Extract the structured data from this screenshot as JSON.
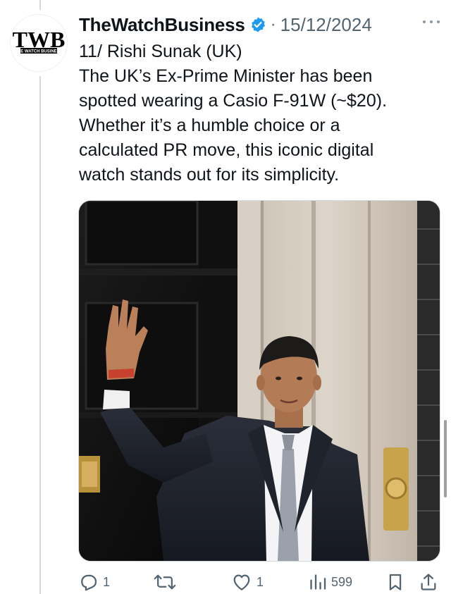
{
  "tweet": {
    "author": {
      "display_name": "TheWatchBusiness",
      "verified": true,
      "avatar_icon": "twb-logo-icon",
      "avatar_text": "TWB",
      "avatar_subtext": "THE WATCH BUSINESS"
    },
    "separator": "·",
    "timestamp": "15/12/2024",
    "text_lines": [
      "11/ Rishi Sunak (UK)",
      "The UK’s Ex-Prime Minister has been",
      "spotted wearing a Casio F-91W (~$20).",
      "Whether it’s a humble choice or a",
      "calculated PR move, this iconic digital",
      "watch stands out for its simplicity."
    ],
    "media": {
      "icon": "photo-man-waving-at-door"
    },
    "actions": {
      "reply": {
        "icon": "reply-icon",
        "count": "1"
      },
      "repost": {
        "icon": "repost-icon",
        "count": ""
      },
      "like": {
        "icon": "like-icon",
        "count": "1"
      },
      "views": {
        "icon": "views-icon",
        "count": "599"
      },
      "bookmark": {
        "icon": "bookmark-icon"
      },
      "share": {
        "icon": "share-icon"
      }
    }
  },
  "colors": {
    "text": "#0f1419",
    "secondary": "#536471",
    "verified": "#1d9bf0",
    "border": "#cfd9de"
  }
}
